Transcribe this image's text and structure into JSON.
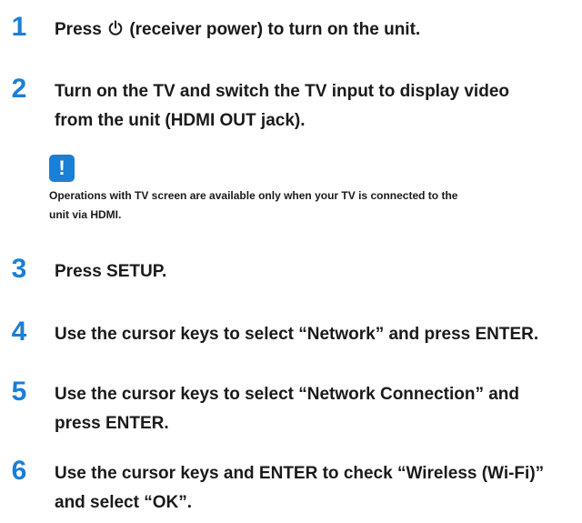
{
  "steps": [
    {
      "number": "1",
      "text_before_icon": "Press ",
      "icon": "power-icon",
      "text_after_icon": " (receiver power) to turn on the unit."
    },
    {
      "number": "2",
      "text": "Turn on the TV and switch the TV input to display video\nfrom the unit (HDMI OUT jack)."
    },
    {
      "number": "3",
      "text": "Press SETUP."
    },
    {
      "number": "4",
      "text": "Use the cursor keys to select “Network” and press ENTER."
    },
    {
      "number": "5",
      "text": "Use the cursor keys to select “Network Connection” and\npress ENTER."
    },
    {
      "number": "6",
      "text": "Use the cursor keys and ENTER to check “Wireless (Wi-Fi)”\nand select “OK”."
    }
  ],
  "note": {
    "icon": "exclamation-icon",
    "icon_text": "!",
    "text": "Operations with TV screen are available only when your TV is connected to the\nunit via HDMI."
  },
  "colors": {
    "accent": "#1a7fd6",
    "text": "#1a1a1a",
    "background": "#ffffff"
  }
}
